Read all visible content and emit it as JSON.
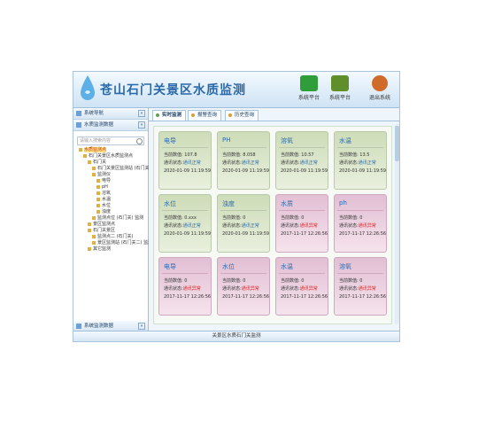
{
  "app": {
    "title": "苍山石门关景区水质监测",
    "buttons": [
      {
        "label": "系统平台",
        "color": "#2f9e3a"
      },
      {
        "label": "系统平台",
        "color": "#5f8e2a"
      },
      {
        "label": "退出系统",
        "color": "#d06a2a"
      }
    ],
    "footer": "关景区水质石门关监测"
  },
  "sidebar": {
    "panel1": "系统导航",
    "panel2": "水质监测数据",
    "search_placeholder": "请输入搜索内容",
    "tree": [
      {
        "label": "水质监测点",
        "depth": 0,
        "selected": true
      },
      {
        "label": "石门关景区水质监测点",
        "depth": 1
      },
      {
        "label": "石门关",
        "depth": 2
      },
      {
        "label": "石门关景区监测站 (石门关)",
        "depth": 3
      },
      {
        "label": "监测仪",
        "depth": 3
      },
      {
        "label": "电导",
        "depth": 4
      },
      {
        "label": "pH",
        "depth": 4
      },
      {
        "label": "溶氧",
        "depth": 4
      },
      {
        "label": "水温",
        "depth": 4
      },
      {
        "label": "水位",
        "depth": 4
      },
      {
        "label": "浊度",
        "depth": 4
      },
      {
        "label": "监测点位 (石门关) 监测",
        "depth": 3
      },
      {
        "label": "景区监测点",
        "depth": 2
      },
      {
        "label": "石门关景区",
        "depth": 2
      },
      {
        "label": "监测点二 (石门关)",
        "depth": 3
      },
      {
        "label": "景区监测站 (石门关二) 监测",
        "depth": 3
      },
      {
        "label": "其它监测",
        "depth": 2
      }
    ],
    "footer": "系统监测数据"
  },
  "tabs": [
    {
      "label": "实时监测"
    },
    {
      "label": "报警查询"
    },
    {
      "label": "历史查询"
    }
  ],
  "cards": [
    {
      "title": "电导",
      "alarm": false,
      "l1": "当前数值: 107.8",
      "l2p": "通讯状态:",
      "l2s": "通讯正常",
      "l3": "2020-01-09 11:19:59"
    },
    {
      "title": "PH",
      "alarm": false,
      "l1": "当前数值: 8.058",
      "l2p": "通讯状态:",
      "l2s": "通讯正常",
      "l3": "2020-01-09 11:19:59"
    },
    {
      "title": "溶氧",
      "alarm": false,
      "l1": "当前数值: 10.57",
      "l2p": "通讯状态:",
      "l2s": "通讯正常",
      "l3": "2020-01-09 11:19:59"
    },
    {
      "title": "水温",
      "alarm": false,
      "l1": "当前数值: 13.5",
      "l2p": "通讯状态:",
      "l2s": "通讯正常",
      "l3": "2020-01-09 11:19:59"
    },
    {
      "title": "水位",
      "alarm": false,
      "l1": "当前数值: 0.xxx",
      "l2p": "通讯状态:",
      "l2s": "通讯正常",
      "l3": "2020-01-09 11:19:59"
    },
    {
      "title": "浊度",
      "alarm": false,
      "l1": "当前数值: 0",
      "l2p": "通讯状态:",
      "l2s": "通讯正常",
      "l3": "2020-01-09 11:19:59"
    },
    {
      "title": "水质",
      "alarm": true,
      "l1": "当前数值: 0",
      "l2p": "通讯状态:",
      "l2s": "通讯异常",
      "l3": "2017-11-17 12:26:56"
    },
    {
      "title": "ph",
      "alarm": true,
      "l1": "当前数值: 0",
      "l2p": "通讯状态:",
      "l2s": "通讯异常",
      "l3": "2017-11-17 12:26:56"
    },
    {
      "title": "电导",
      "alarm": true,
      "l1": "当前数值: 0",
      "l2p": "通讯状态:",
      "l2s": "通讯异常",
      "l3": "2017-11-17 12:26:56"
    },
    {
      "title": "水位",
      "alarm": true,
      "l1": "当前数值: 0",
      "l2p": "通讯状态:",
      "l2s": "通讯异常",
      "l3": "2017-11-17 12:26:56"
    },
    {
      "title": "水温",
      "alarm": true,
      "l1": "当前数值: 0",
      "l2p": "通讯状态:",
      "l2s": "通讯异常",
      "l3": "2017-11-17 12:26:56"
    },
    {
      "title": "溶氧",
      "alarm": true,
      "l1": "当前数值: 0",
      "l2p": "通讯状态:",
      "l2s": "通讯异常",
      "l3": "2017-11-17 12:26:56"
    }
  ]
}
